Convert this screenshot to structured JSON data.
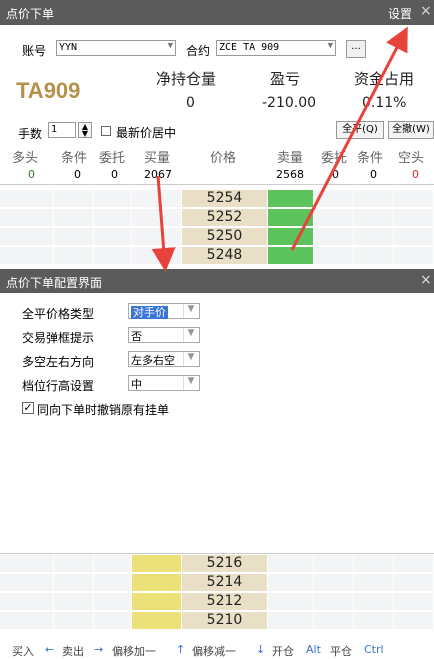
{
  "window": {
    "title": "点价下单",
    "settings_label": "设置",
    "close": "×"
  },
  "account": {
    "label": "账号",
    "value": "YYN"
  },
  "contract": {
    "label": "合约",
    "value": "ZCE TA 909",
    "more": "..."
  },
  "summary": {
    "symbol": "TA909",
    "net_position_label": "净持仓量",
    "net_position": "0",
    "pnl_label": "盈亏",
    "pnl": "-210.00",
    "margin_label": "资金占用",
    "margin": "0.11%"
  },
  "controls": {
    "lots_label": "手数",
    "lots_value": "1",
    "latest_center_label": "最新价居中",
    "close_all_q": "全平(Q)",
    "cancel_all_w": "全撤(W)"
  },
  "grid": {
    "headers": [
      "多头",
      "条件",
      "委托",
      "买量",
      "价格",
      "卖量",
      "委托",
      "条件",
      "空头"
    ],
    "summary_row": [
      "0",
      "0",
      "0",
      "2067",
      "",
      "2568",
      "0",
      "0",
      "0"
    ],
    "top_prices": [
      "5254",
      "5252",
      "5250",
      "5248"
    ],
    "bottom_prices": [
      "5216",
      "5214",
      "5212",
      "5210"
    ]
  },
  "config": {
    "title": "点价下单配置界面",
    "close": "×",
    "rows": [
      {
        "label": "全平价格类型",
        "value": "对手价"
      },
      {
        "label": "交易弹框提示",
        "value": "否"
      },
      {
        "label": "多空左右方向",
        "value": "左多右空"
      },
      {
        "label": "档位行高设置",
        "value": "中"
      }
    ],
    "checkbox_label": "同向下单时撤销原有挂单",
    "checkbox_checked": true
  },
  "statusbar": {
    "buy": "买入",
    "left_arrow": "←",
    "sell": "卖出",
    "right_arrow": "→",
    "offset_up": "偏移加一",
    "up_arrow": "↑",
    "offset_down": "偏移减一",
    "down_arrow": "↓",
    "open": "开仓",
    "alt": "Alt",
    "close": "平仓",
    "ctrl": "Ctrl"
  },
  "colors": {
    "titlebar": "#5b5b5b",
    "arrow": "#e8433a",
    "green": "#5cc35c",
    "yellow": "#ece079",
    "price": "#e8dfc6"
  }
}
